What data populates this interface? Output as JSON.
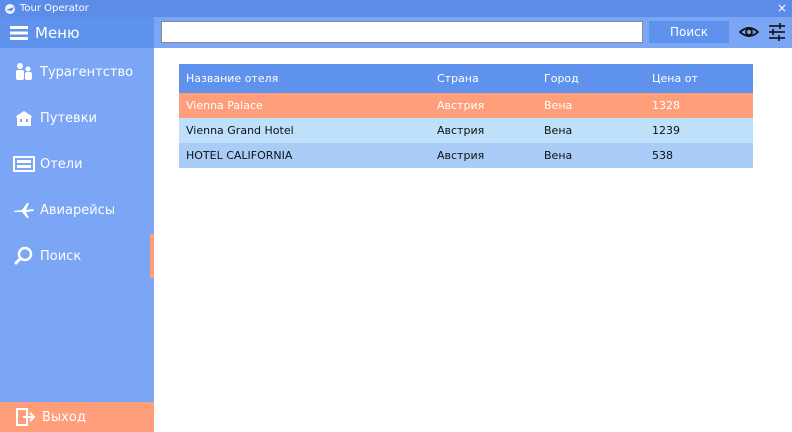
{
  "window": {
    "title": "Tour Operator",
    "close_glyph": "×"
  },
  "sidebar": {
    "menu_label": "Меню",
    "items": [
      {
        "label": "Турагентство",
        "icon": "people-icon"
      },
      {
        "label": "Путевки",
        "icon": "building-icon"
      },
      {
        "label": "Отели",
        "icon": "hotel-sign-icon"
      },
      {
        "label": "Авиарейсы",
        "icon": "airplane-icon"
      },
      {
        "label": "Поиск",
        "icon": "magnifier-icon",
        "active": true
      }
    ],
    "exit_label": "Выход"
  },
  "toolbar": {
    "search_value": "",
    "search_button": "Поиск"
  },
  "table": {
    "columns": [
      "Название отеля",
      "Страна",
      "Город",
      "Цена от"
    ],
    "rows": [
      [
        "Vienna Palace",
        "Австрия",
        "Вена",
        "1328"
      ],
      [
        "Vienna Grand Hotel",
        "Австрия",
        "Вена",
        "1239"
      ],
      [
        "HOTEL CALIFORNIA",
        "Австрия",
        "Вена",
        "538"
      ]
    ],
    "selected_row": 0
  },
  "colors": {
    "titlebar": "#5b8de8",
    "sidebar": "#7aa6f5",
    "accent": "#5e92ec",
    "selection": "#ff9e7a",
    "row_alt1": "#bfe0fb",
    "row_alt2": "#a9cdf7"
  }
}
